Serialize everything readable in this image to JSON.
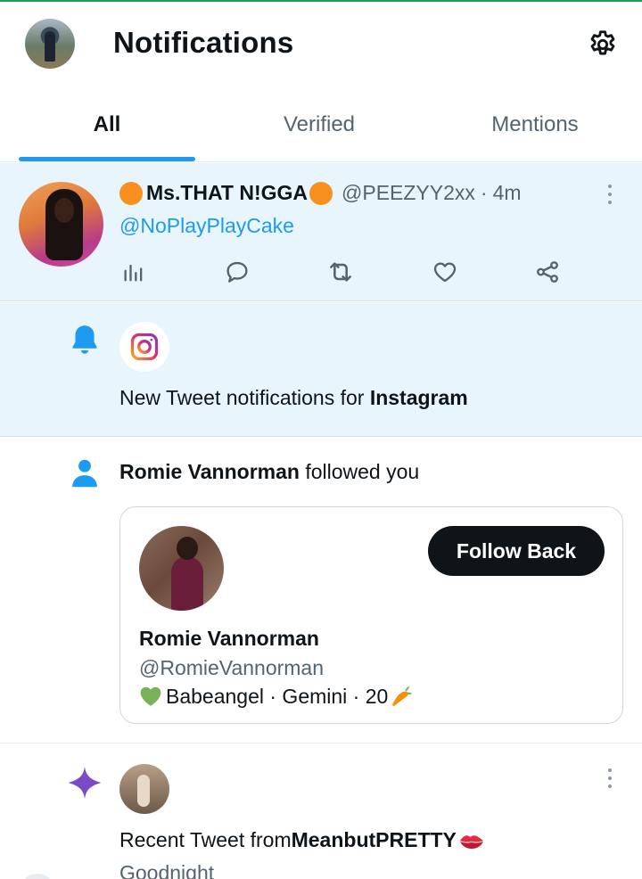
{
  "header": {
    "title": "Notifications",
    "avatar_icon": "user-avatar",
    "settings_icon": "gear-icon"
  },
  "tabs": [
    {
      "label": "All",
      "active": true
    },
    {
      "label": "Verified",
      "active": false
    },
    {
      "label": "Mentions",
      "active": false
    }
  ],
  "tweet": {
    "display_name": "Ms.THAT N!GGA",
    "handle": "@PEEZYY2xx",
    "separator": "·",
    "time": "4m",
    "mention": "@NoPlayPlayCake",
    "actions": [
      "views-icon",
      "reply-icon",
      "retweet-icon",
      "like-icon",
      "share-icon"
    ]
  },
  "notification_instagram": {
    "text_prefix": "New Tweet notifications for ",
    "account": "Instagram"
  },
  "notification_follow": {
    "name": "Romie Vannorman",
    "text_suffix": " followed you",
    "card": {
      "name": "Romie Vannorman",
      "handle": "@RomieVannorman",
      "bio": "Babeangel · Gemini · 20",
      "button_label": "Follow Back"
    }
  },
  "notification_recent": {
    "text_prefix": "Recent Tweet from ",
    "account": "MeanbutPRETTY",
    "preview": "Goodnight"
  },
  "colors": {
    "accent": "#1d9bf0",
    "highlight_bg": "#e8f5fd",
    "sparkle": "#794bc4",
    "text_primary": "#0f1419",
    "text_secondary": "#536471"
  }
}
